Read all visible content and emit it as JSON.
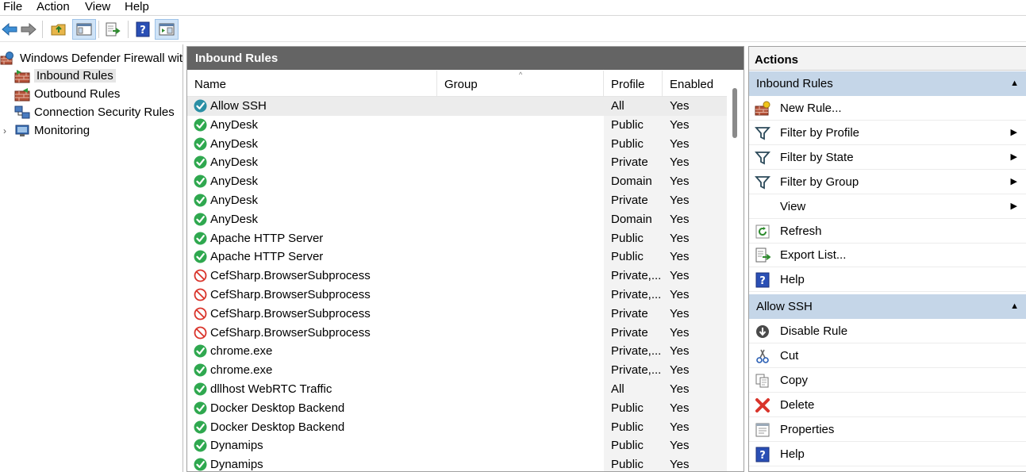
{
  "menubar": {
    "items": [
      "File",
      "Action",
      "View",
      "Help"
    ]
  },
  "toolbar": {
    "buttons": [
      "back-icon",
      "forward-icon",
      "up-folder-icon",
      "show-hide-tree-icon",
      "export-icon",
      "help-icon",
      "show-hide-action-pane-icon"
    ]
  },
  "tree": {
    "root": "Windows Defender Firewall with",
    "items": [
      {
        "label": "Inbound Rules",
        "selected": true
      },
      {
        "label": "Outbound Rules",
        "selected": false
      },
      {
        "label": "Connection Security Rules",
        "selected": false
      },
      {
        "label": "Monitoring",
        "selected": false,
        "expandable": true
      }
    ]
  },
  "center": {
    "title": "Inbound Rules",
    "columns": {
      "name": "Name",
      "group": "Group",
      "profile": "Profile",
      "enabled": "Enabled"
    },
    "rows": [
      {
        "name": "Allow SSH",
        "status": "allow-selected",
        "profile": "All",
        "enabled": "Yes"
      },
      {
        "name": "AnyDesk",
        "status": "allow",
        "profile": "Public",
        "enabled": "Yes"
      },
      {
        "name": "AnyDesk",
        "status": "allow",
        "profile": "Public",
        "enabled": "Yes"
      },
      {
        "name": "AnyDesk",
        "status": "allow",
        "profile": "Private",
        "enabled": "Yes"
      },
      {
        "name": "AnyDesk",
        "status": "allow",
        "profile": "Domain",
        "enabled": "Yes"
      },
      {
        "name": "AnyDesk",
        "status": "allow",
        "profile": "Private",
        "enabled": "Yes"
      },
      {
        "name": "AnyDesk",
        "status": "allow",
        "profile": "Domain",
        "enabled": "Yes"
      },
      {
        "name": "Apache HTTP Server",
        "status": "allow",
        "profile": "Public",
        "enabled": "Yes"
      },
      {
        "name": "Apache HTTP Server",
        "status": "allow",
        "profile": "Public",
        "enabled": "Yes"
      },
      {
        "name": "CefSharp.BrowserSubprocess",
        "status": "block",
        "profile": "Private,...",
        "enabled": "Yes"
      },
      {
        "name": "CefSharp.BrowserSubprocess",
        "status": "block",
        "profile": "Private,...",
        "enabled": "Yes"
      },
      {
        "name": "CefSharp.BrowserSubprocess",
        "status": "block",
        "profile": "Private",
        "enabled": "Yes"
      },
      {
        "name": "CefSharp.BrowserSubprocess",
        "status": "block",
        "profile": "Private",
        "enabled": "Yes"
      },
      {
        "name": "chrome.exe",
        "status": "allow",
        "profile": "Private,...",
        "enabled": "Yes"
      },
      {
        "name": "chrome.exe",
        "status": "allow",
        "profile": "Private,...",
        "enabled": "Yes"
      },
      {
        "name": "dllhost WebRTC Traffic",
        "status": "allow",
        "profile": "All",
        "enabled": "Yes"
      },
      {
        "name": "Docker Desktop Backend",
        "status": "allow",
        "profile": "Public",
        "enabled": "Yes"
      },
      {
        "name": "Docker Desktop Backend",
        "status": "allow",
        "profile": "Public",
        "enabled": "Yes"
      },
      {
        "name": "Dynamips",
        "status": "allow",
        "profile": "Public",
        "enabled": "Yes"
      },
      {
        "name": "Dynamips",
        "status": "allow",
        "profile": "Public",
        "enabled": "Yes"
      }
    ]
  },
  "actions": {
    "title": "Actions",
    "sections": [
      {
        "title": "Inbound Rules",
        "items": [
          {
            "label": "New Rule...",
            "icon": "new-rule-icon",
            "submenu": false
          },
          {
            "label": "Filter by Profile",
            "icon": "filter-icon",
            "submenu": true
          },
          {
            "label": "Filter by State",
            "icon": "filter-icon",
            "submenu": true
          },
          {
            "label": "Filter by Group",
            "icon": "filter-icon",
            "submenu": true
          },
          {
            "label": "View",
            "icon": "",
            "submenu": true
          },
          {
            "label": "Refresh",
            "icon": "refresh-icon",
            "submenu": false
          },
          {
            "label": "Export List...",
            "icon": "export-icon",
            "submenu": false
          },
          {
            "label": "Help",
            "icon": "help-icon",
            "submenu": false
          }
        ]
      },
      {
        "title": "Allow SSH",
        "items": [
          {
            "label": "Disable Rule",
            "icon": "disable-rule-icon",
            "submenu": false
          },
          {
            "label": "Cut",
            "icon": "cut-icon",
            "submenu": false
          },
          {
            "label": "Copy",
            "icon": "copy-icon",
            "submenu": false
          },
          {
            "label": "Delete",
            "icon": "delete-icon",
            "submenu": false
          },
          {
            "label": "Properties",
            "icon": "properties-icon",
            "submenu": false
          },
          {
            "label": "Help",
            "icon": "help-icon",
            "submenu": false
          }
        ]
      }
    ]
  },
  "colors": {
    "section_header_bg": "#c5d6e8",
    "center_header_bg": "#646464",
    "allow_green": "#2fa84f",
    "block_red": "#d9342b",
    "selected_teal": "#2a8fa5"
  }
}
